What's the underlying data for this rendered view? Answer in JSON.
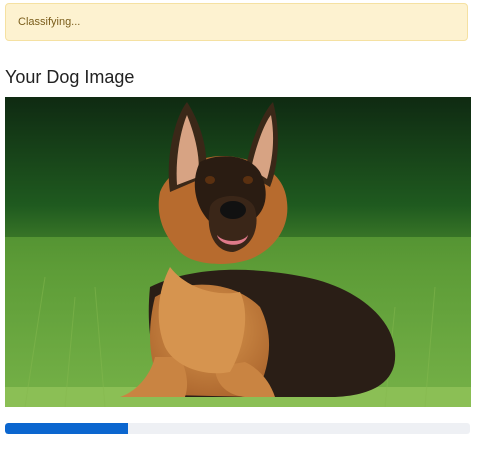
{
  "alert": {
    "status_text": "Classifying...",
    "style": "warning"
  },
  "section": {
    "title": "Your Dog Image"
  },
  "image": {
    "subject": "german-shepherd-dog-photo"
  },
  "progress": {
    "value_fraction": 0.265,
    "fill_color": "#0b66cf",
    "track_color": "#eef0f4"
  }
}
